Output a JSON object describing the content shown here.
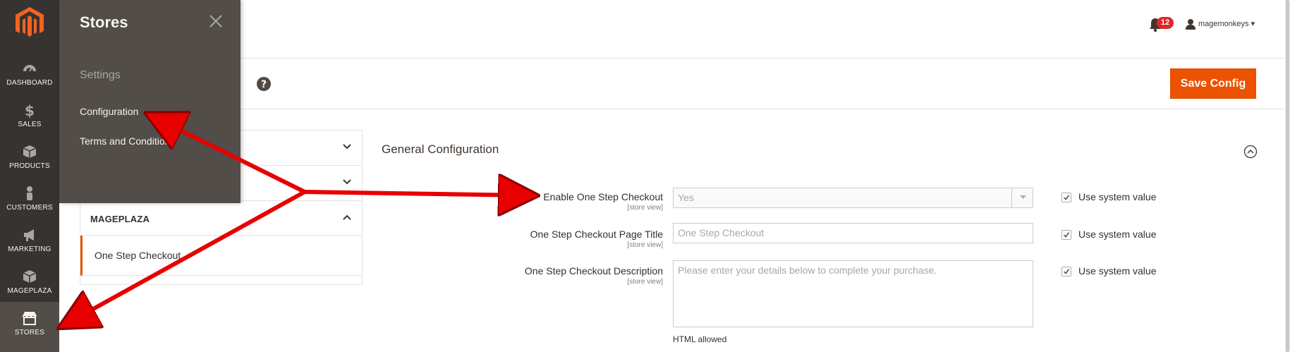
{
  "admin_nav": {
    "items": [
      {
        "label": "DASHBOARD",
        "icon": "dashboard-icon"
      },
      {
        "label": "SALES",
        "icon": "dollar-icon"
      },
      {
        "label": "PRODUCTS",
        "icon": "box-icon"
      },
      {
        "label": "CUSTOMERS",
        "icon": "person-icon"
      },
      {
        "label": "MARKETING",
        "icon": "megaphone-icon"
      },
      {
        "label": "MAGEPLAZA",
        "icon": "box-icon"
      },
      {
        "label": "STORES",
        "icon": "store-icon",
        "active": true
      }
    ]
  },
  "flyout": {
    "title": "Stores",
    "section": "Settings",
    "links": [
      "Configuration",
      "Terms and Conditions"
    ]
  },
  "header": {
    "notifications_count": "12",
    "username": "magemonkeys"
  },
  "actions": {
    "save_label": "Save Config"
  },
  "config_tabs": {
    "group_title": "MAGEPLAZA",
    "item": "One Step Checkout"
  },
  "section": {
    "title": "General Configuration",
    "fields": [
      {
        "label": "Enable One Step Checkout",
        "scope": "[store view]",
        "value": "Yes",
        "type": "select",
        "system_label": "Use system value"
      },
      {
        "label": "One Step Checkout Page Title",
        "scope": "[store view]",
        "value": "One Step Checkout",
        "type": "text",
        "system_label": "Use system value"
      },
      {
        "label": "One Step Checkout Description",
        "scope": "[store view]",
        "value": "Please enter your details below to complete your purchase.",
        "type": "textarea",
        "system_label": "Use system value"
      }
    ],
    "note": "HTML allowed"
  },
  "colors": {
    "accent": "#eb5202",
    "nav_bg": "#373330",
    "flyout_bg": "#524d49",
    "annotation_arrow": "#e80000"
  }
}
